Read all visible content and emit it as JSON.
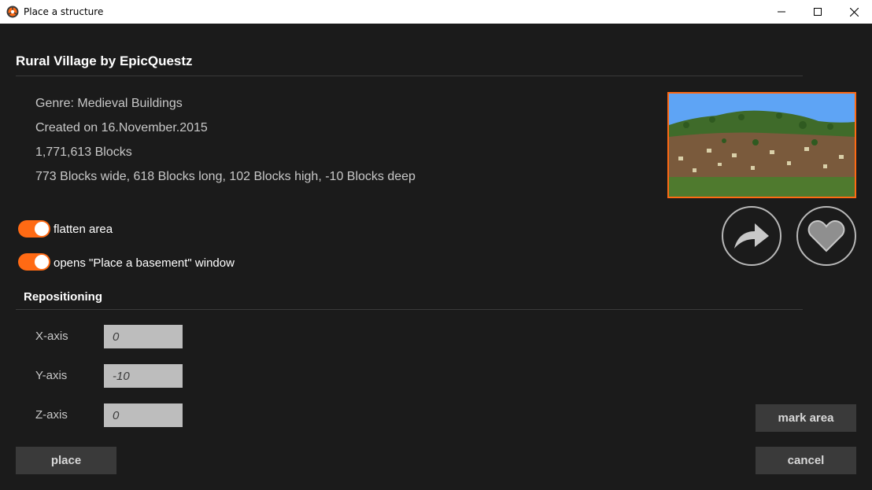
{
  "window": {
    "title": "Place a structure",
    "app_icon": "firefox-like-orange-icon",
    "controls": [
      "minimize-icon",
      "maximize-icon",
      "close-icon"
    ]
  },
  "structure": {
    "name": "Rural Village by EpicQuestz",
    "genre": "Genre: Medieval Buildings",
    "created": "Created on 16.November.2015",
    "blocks": "1,771,613 Blocks",
    "dimensions": "773 Blocks wide, 618 Blocks long, 102 Blocks high, -10 Blocks deep"
  },
  "actions": {
    "share_icon": "share-arrow-icon",
    "favorite_icon": "heart-icon"
  },
  "options": {
    "flatten_label": "flatten area",
    "flatten_on": true,
    "basement_label": "opens \"Place a basement\" window",
    "basement_on": true
  },
  "repositioning": {
    "title": "Repositioning",
    "x_label": "X-axis",
    "x_value": "0",
    "y_label": "Y-axis",
    "y_value": "-10",
    "z_label": "Z-axis",
    "z_value": "0"
  },
  "buttons": {
    "mark_area": "mark area",
    "place": "place",
    "cancel": "cancel"
  },
  "colors": {
    "accent": "#ff6a14",
    "background": "#1b1b1b",
    "button": "#3a3a3a",
    "input": "#bdbdbd"
  }
}
